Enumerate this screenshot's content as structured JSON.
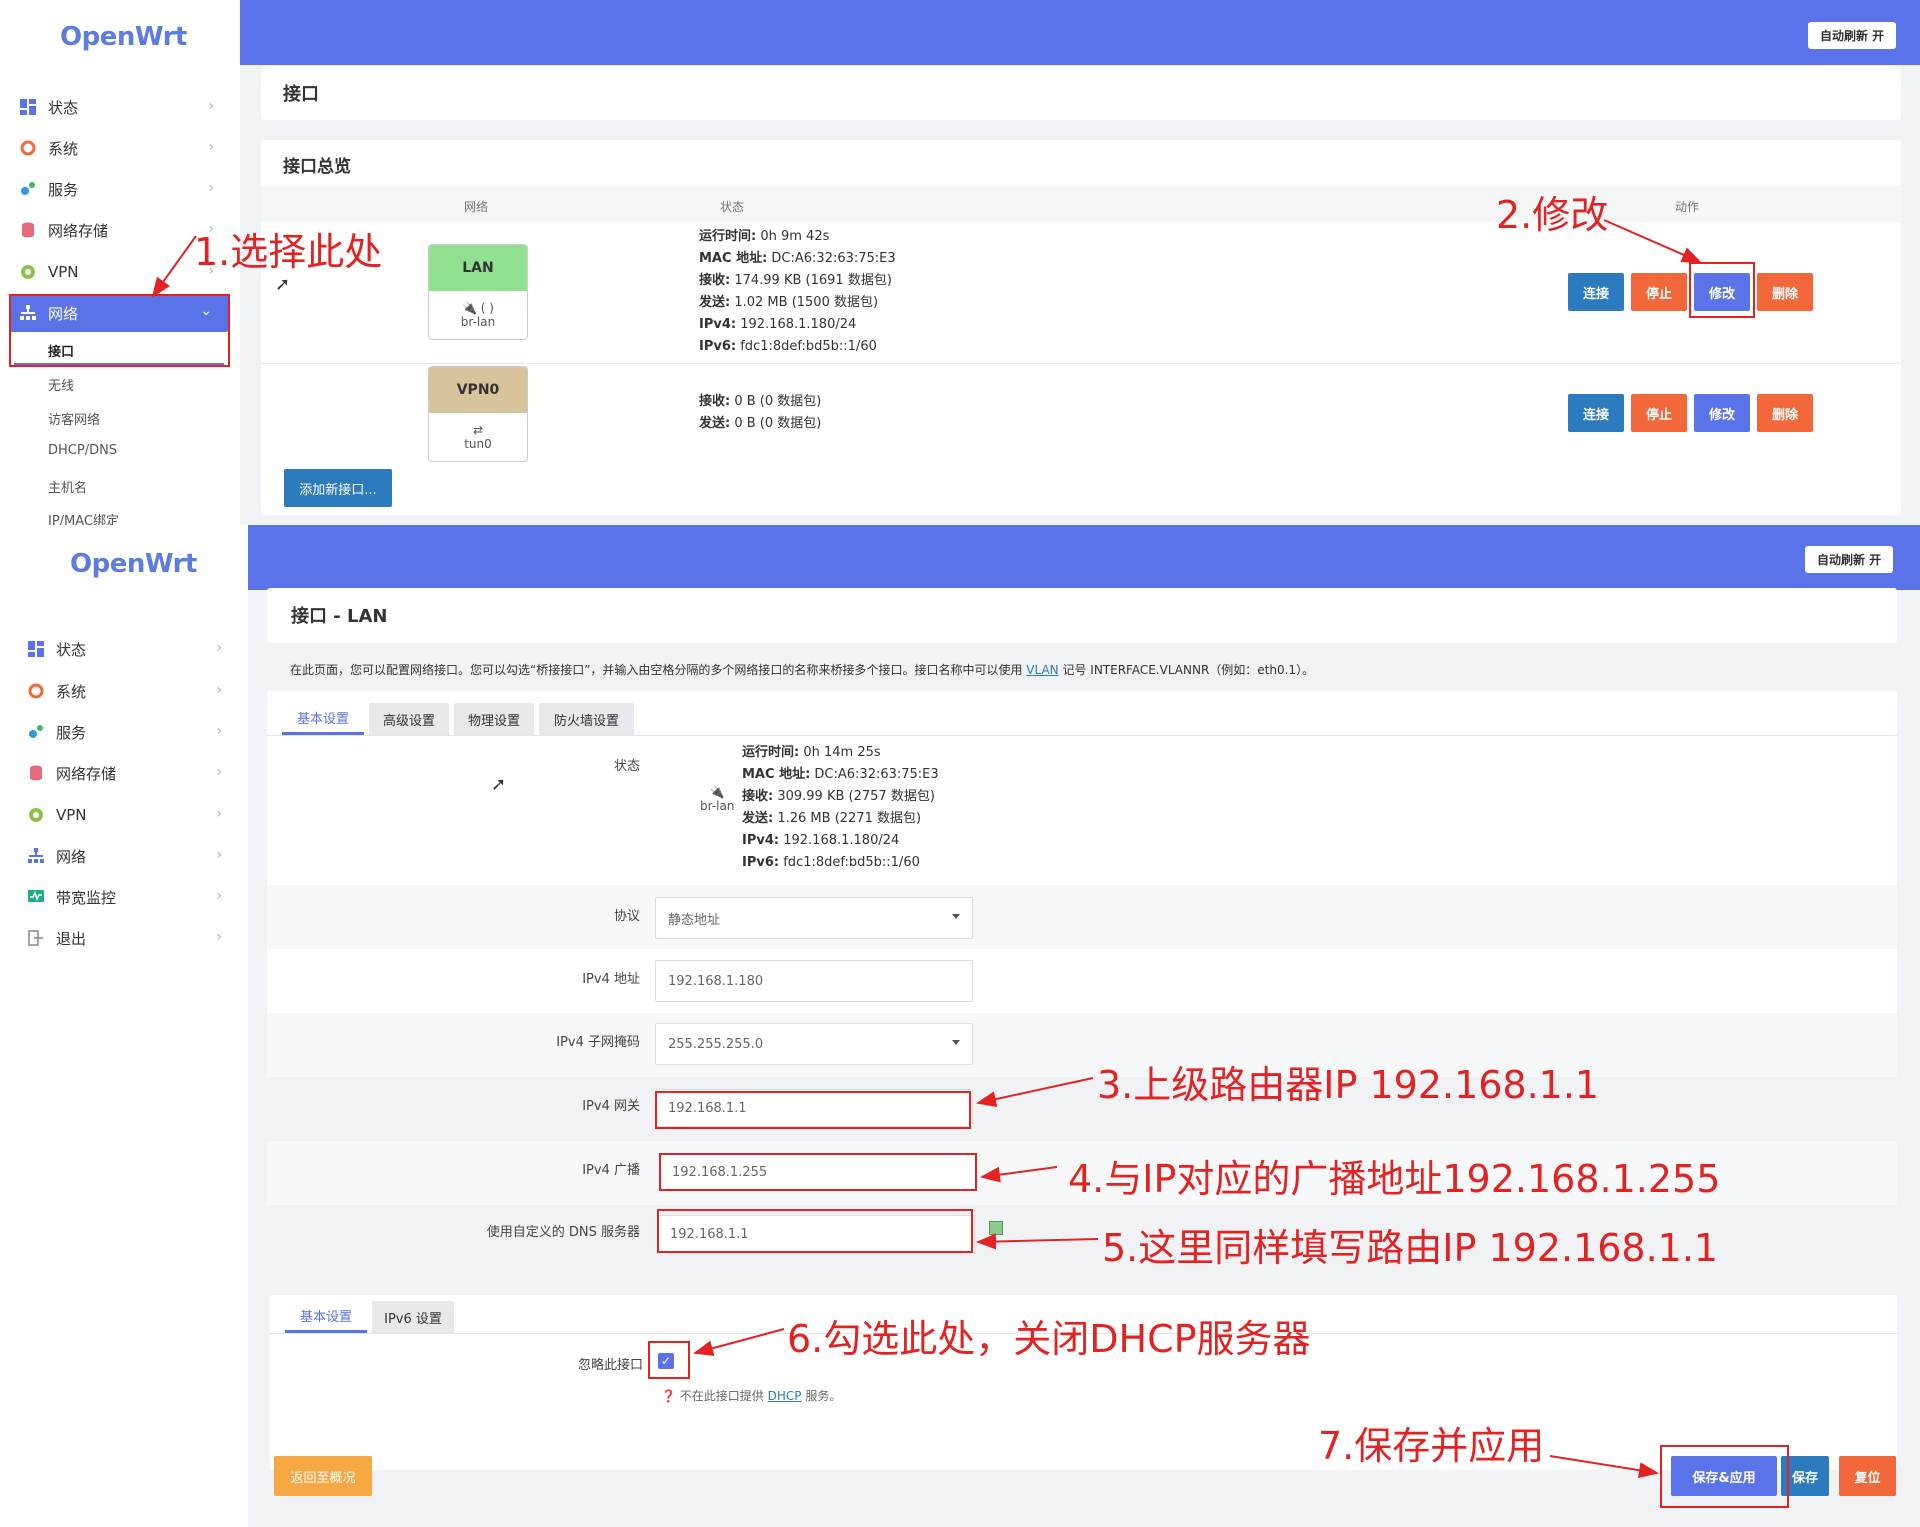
{
  "brand": "OpenWrt",
  "auto_refresh": "自动刷新 开",
  "top": {
    "sidebar": {
      "items": [
        {
          "label": "状态",
          "icon": "dashboard-icon"
        },
        {
          "label": "系统",
          "icon": "gear-icon"
        },
        {
          "label": "服务",
          "icon": "services-icon"
        },
        {
          "label": "网络存储",
          "icon": "storage-icon"
        },
        {
          "label": "VPN",
          "icon": "vpn-icon"
        },
        {
          "label": "网络",
          "icon": "network-icon"
        }
      ],
      "sub_items": [
        "接口",
        "无线",
        "访客网络",
        "DHCP/DNS",
        "主机名",
        "IP/MAC绑定"
      ]
    },
    "page_title": "接口",
    "overview_title": "接口总览",
    "table_headers": {
      "network": "网络",
      "status": "状态",
      "actions": "动作"
    },
    "rows": [
      {
        "name": "LAN",
        "device": "br-lan",
        "device_icons": "(  )",
        "status": [
          {
            "k": "运行时间:",
            "v": "0h 9m 42s"
          },
          {
            "k": "MAC 地址:",
            "v": "DC:A6:32:63:75:E3"
          },
          {
            "k": "接收:",
            "v": "174.99 KB (1691 数据包)"
          },
          {
            "k": "发送:",
            "v": "1.02 MB (1500 数据包)"
          },
          {
            "k": "IPv4:",
            "v": "192.168.1.180/24"
          },
          {
            "k": "IPv6:",
            "v": "fdc1:8def:bd5b::1/60"
          }
        ]
      },
      {
        "name": "VPN0",
        "device": "tun0",
        "status": [
          {
            "k": "接收:",
            "v": "0 B (0 数据包)"
          },
          {
            "k": "发送:",
            "v": "0 B (0 数据包)"
          }
        ]
      }
    ],
    "buttons": {
      "connect": "连接",
      "stop": "停止",
      "edit": "修改",
      "delete": "删除",
      "add": "添加新接口..."
    }
  },
  "bottom": {
    "sidebar": {
      "items": [
        {
          "label": "状态",
          "icon": "dashboard-icon"
        },
        {
          "label": "系统",
          "icon": "gear-icon"
        },
        {
          "label": "服务",
          "icon": "services-icon"
        },
        {
          "label": "网络存储",
          "icon": "storage-icon"
        },
        {
          "label": "VPN",
          "icon": "vpn-icon"
        },
        {
          "label": "网络",
          "icon": "network-icon"
        },
        {
          "label": "带宽监控",
          "icon": "bandwidth-icon"
        },
        {
          "label": "退出",
          "icon": "logout-icon"
        }
      ]
    },
    "page_title": "接口 - LAN",
    "description_prefix": "在此页面，您可以配置网络接口。您可以勾选“桥接接口”，并输入由空格分隔的多个网络接口的名称来桥接多个接口。接口名称中可以使用",
    "description_link": "VLAN",
    "description_suffix": "记号 INTERFACE.VLANNR（例如：eth0.1）。",
    "tabs": [
      "基本设置",
      "高级设置",
      "物理设置",
      "防火墙设置"
    ],
    "status_label": "状态",
    "status_device": "br-lan",
    "status": [
      {
        "k": "运行时间:",
        "v": "0h 14m 25s"
      },
      {
        "k": "MAC 地址:",
        "v": "DC:A6:32:63:75:E3"
      },
      {
        "k": "接收:",
        "v": "309.99 KB (2757 数据包)"
      },
      {
        "k": "发送:",
        "v": "1.26 MB (2271 数据包)"
      },
      {
        "k": "IPv4:",
        "v": "192.168.1.180/24"
      },
      {
        "k": "IPv6:",
        "v": "fdc1:8def:bd5b::1/60"
      }
    ],
    "fields": {
      "protocol": {
        "label": "协议",
        "value": "静态地址"
      },
      "ipv4_addr": {
        "label": "IPv4 地址",
        "value": "192.168.1.180"
      },
      "netmask": {
        "label": "IPv4 子网掩码",
        "value": "255.255.255.0"
      },
      "gateway": {
        "label": "IPv4 网关",
        "value": "192.168.1.1"
      },
      "broadcast": {
        "label": "IPv4 广播",
        "value": "192.168.1.255"
      },
      "dns": {
        "label": "使用自定义的 DNS 服务器",
        "value": "192.168.1.1"
      }
    },
    "dhcp_tabs": [
      "基本设置",
      "IPv6 设置"
    ],
    "ignore_label": "忽略此接口",
    "ignore_checked": true,
    "ignore_help_prefix": "不在此接口提供",
    "ignore_help_link": "DHCP",
    "ignore_help_suffix": "服务。",
    "buttons": {
      "back": "返回至概况",
      "save_apply": "保存&应用",
      "save": "保存",
      "reset": "复位"
    }
  },
  "annotations": [
    "1.选择此处",
    "2.修改",
    "3.上级路由器IP 192.168.1.1",
    "4.与IP对应的广播地址192.168.1.255",
    "5.这里同样填写路由IP   192.168.1.1",
    "6.勾选此处，关闭DHCP服务器",
    "7.保存并应用"
  ],
  "colors": {
    "accent": "#5b73e8",
    "annotation": "#e32222",
    "blue_btn": "#2d7bbf",
    "orange_btn": "#f2683b",
    "lan_head": "#90e090",
    "vpn_head": "#d8c39c"
  }
}
